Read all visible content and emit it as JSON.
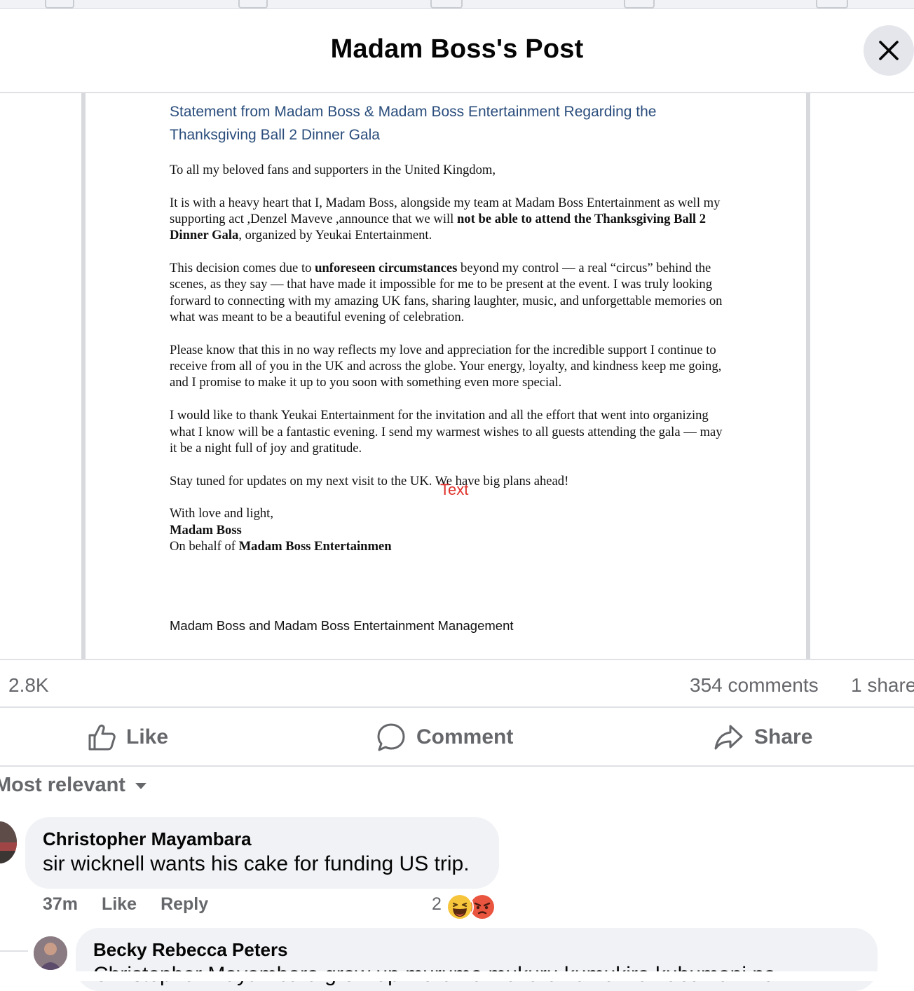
{
  "header": {
    "title": "Madam Boss's Post",
    "close_icon": "close-icon"
  },
  "document": {
    "title_line1": "Statement from Madam Boss & Madam Boss Entertainment Regarding the",
    "title_line2": "Thanksgiving Ball 2 Dinner Gala",
    "greeting": "To all my beloved fans and supporters in the United Kingdom,",
    "p1_a": "It is with a heavy heart that I, Madam Boss, alongside my team at Madam Boss Entertainment as well my supporting act ,Denzel Maveve ,announce that we will ",
    "p1_b": "not be able to attend the Thanksgiving Ball 2 Dinner Gala",
    "p1_c": ", organized by Yeukai Entertainment.",
    "p2_a": "This decision comes due to ",
    "p2_b": "unforeseen circumstances",
    "p2_c": " beyond my control — a real “circus” behind the scenes, as they say — that have made it impossible for me to be present at the event. I was truly looking forward to connecting with my amazing UK fans, sharing laughter, music, and unforgettable memories on what was meant to be a beautiful evening of celebration.",
    "p3": "Please know that this in no way reflects my love and appreciation for the incredible support I continue to receive from all of you in the UK and across the globe. Your energy, loyalty, and kindness keep me going, and I promise to make it up to you soon with something even more special.",
    "p4": "I would like to thank Yeukai Entertainment for the invitation and all the effort that went into organizing what I know will be a fantastic evening. I send my warmest wishes to all guests attending the gala — may it be a night full of joy and gratitude.",
    "p5": "Stay tuned for updates on my next visit to the UK. We have big plans ahead!",
    "sign_line1": "With love and light,",
    "sign_name": "Madam Boss",
    "sign_behalf": "On behalf of ",
    "sign_org": "Madam Boss Entertainmen",
    "text_mark": "Text",
    "management": "Madam Boss and Madam Boss Entertainment Management"
  },
  "stats": {
    "reactions": "2.8K",
    "comments": "354 comments",
    "shares": "1 share"
  },
  "actions": {
    "like": "Like",
    "comment": "Comment",
    "share": "Share"
  },
  "sort": {
    "label": "Most relevant"
  },
  "comments": [
    {
      "author": "Christopher Mayambara",
      "text": "sir wicknell wants his cake for funding US trip.",
      "time": "37m",
      "like": "Like",
      "reply": "Reply",
      "reaction_count": "2"
    },
    {
      "author": "Becky Rebecca Peters",
      "text": "Christopher Mayambara grow up murume mukuru kumukira kubumani na"
    }
  ],
  "colors": {
    "accent_text": "#65676b",
    "doc_title": "#2a4d7c",
    "bubble": "#f0f2f5"
  }
}
